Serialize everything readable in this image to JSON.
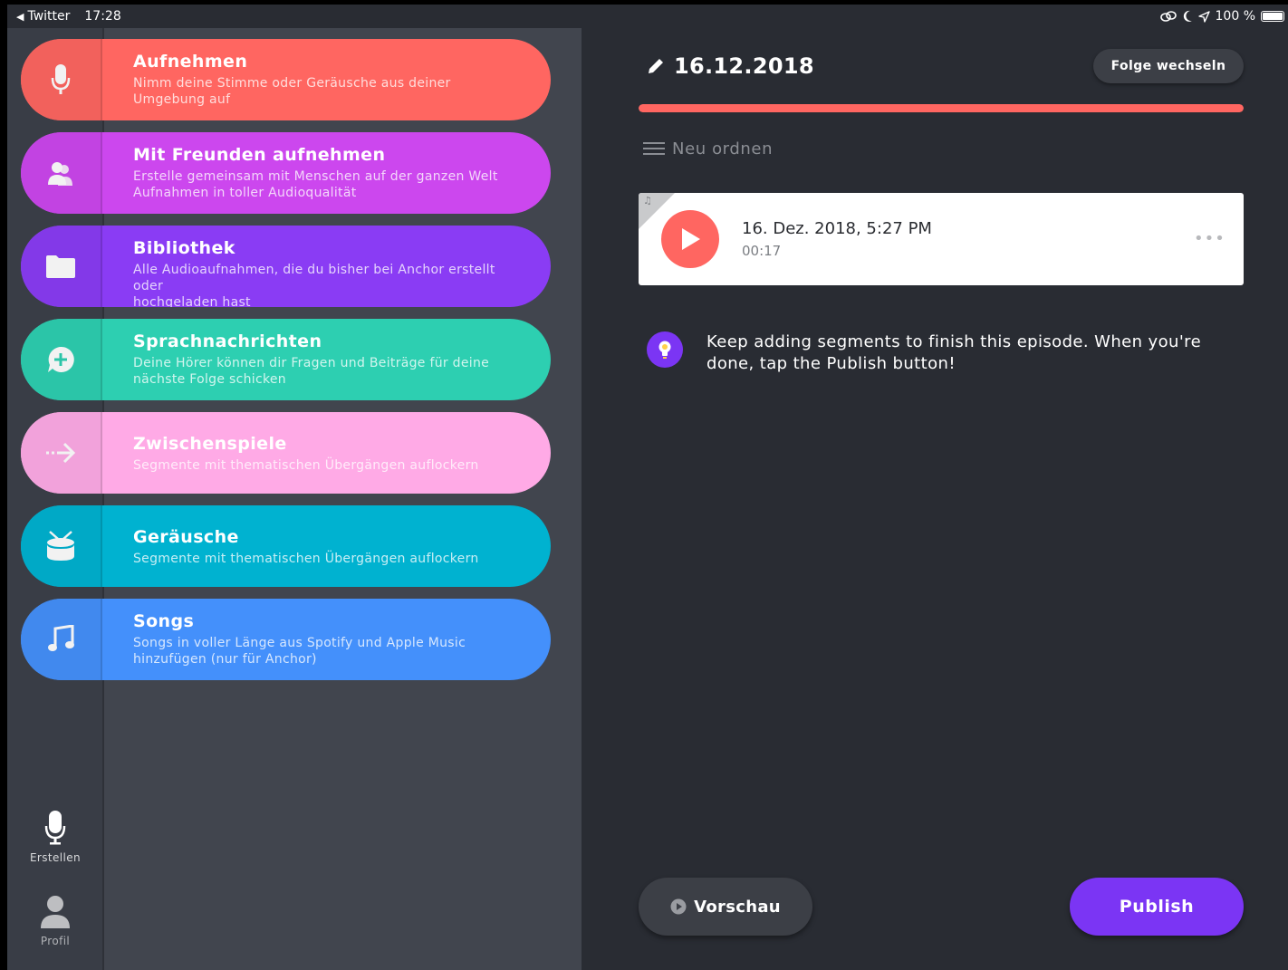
{
  "status_bar": {
    "back_app": "Twitter",
    "time": "17:28",
    "battery": "100 %"
  },
  "menu": {
    "items": [
      {
        "title": "Aufnehmen",
        "desc_line1": "Nimm deine Stimme oder Geräusche aus deiner",
        "desc_line2": "Umgebung auf",
        "color": "#ff6661",
        "icon": "microphone-icon"
      },
      {
        "title": "Mit Freunden aufnehmen",
        "desc_line1": "Erstelle gemeinsam mit Menschen auf der ganzen Welt",
        "desc_line2": "Aufnahmen in toller Audioqualität",
        "color": "#cc47ee",
        "icon": "friends-icon"
      },
      {
        "title": "Bibliothek",
        "desc_line1": "Alle Audioaufnahmen, die du bisher bei Anchor erstellt oder",
        "desc_line2": "hochgeladen hast",
        "color": "#8a3cf4",
        "icon": "folder-icon"
      },
      {
        "title": "Sprachnachrichten",
        "desc_line1": "Deine Hörer können dir Fragen und Beiträge für deine",
        "desc_line2": "nächste Folge schicken",
        "color": "#2dcfb1",
        "icon": "message-plus-icon"
      },
      {
        "title": "Zwischenspiele",
        "desc_line1": "Segmente mit thematischen Übergängen auflockern",
        "desc_line2": "",
        "color": "#ffaae6",
        "icon": "arrow-right-icon"
      },
      {
        "title": "Geräusche",
        "desc_line1": "Segmente mit thematischen Übergängen auflockern",
        "desc_line2": "",
        "color": "#00b2d0",
        "icon": "drum-icon"
      },
      {
        "title": "Songs",
        "desc_line1": "Songs in voller Länge aus Spotify und Apple Music",
        "desc_line2": "hinzufügen (nur für Anchor)",
        "color": "#4490fb",
        "icon": "music-note-icon"
      }
    ]
  },
  "nav": {
    "create_label": "Erstellen",
    "profile_label": "Profil"
  },
  "episode": {
    "title": "16.12.2018",
    "switch_label": "Folge wechseln",
    "progress": 1.0,
    "reorder_label": "Neu ordnen",
    "segment": {
      "date": "16. Dez. 2018, 5:27 PM",
      "duration": "00:17",
      "more": "•••"
    },
    "tip": "Keep adding segments to finish this episode. When you're done, tap the Publish button!",
    "preview_label": "Vorschau",
    "publish_label": "Publish"
  },
  "colors": {
    "accent_red": "#ff6661",
    "accent_purple": "#7b35f4"
  }
}
